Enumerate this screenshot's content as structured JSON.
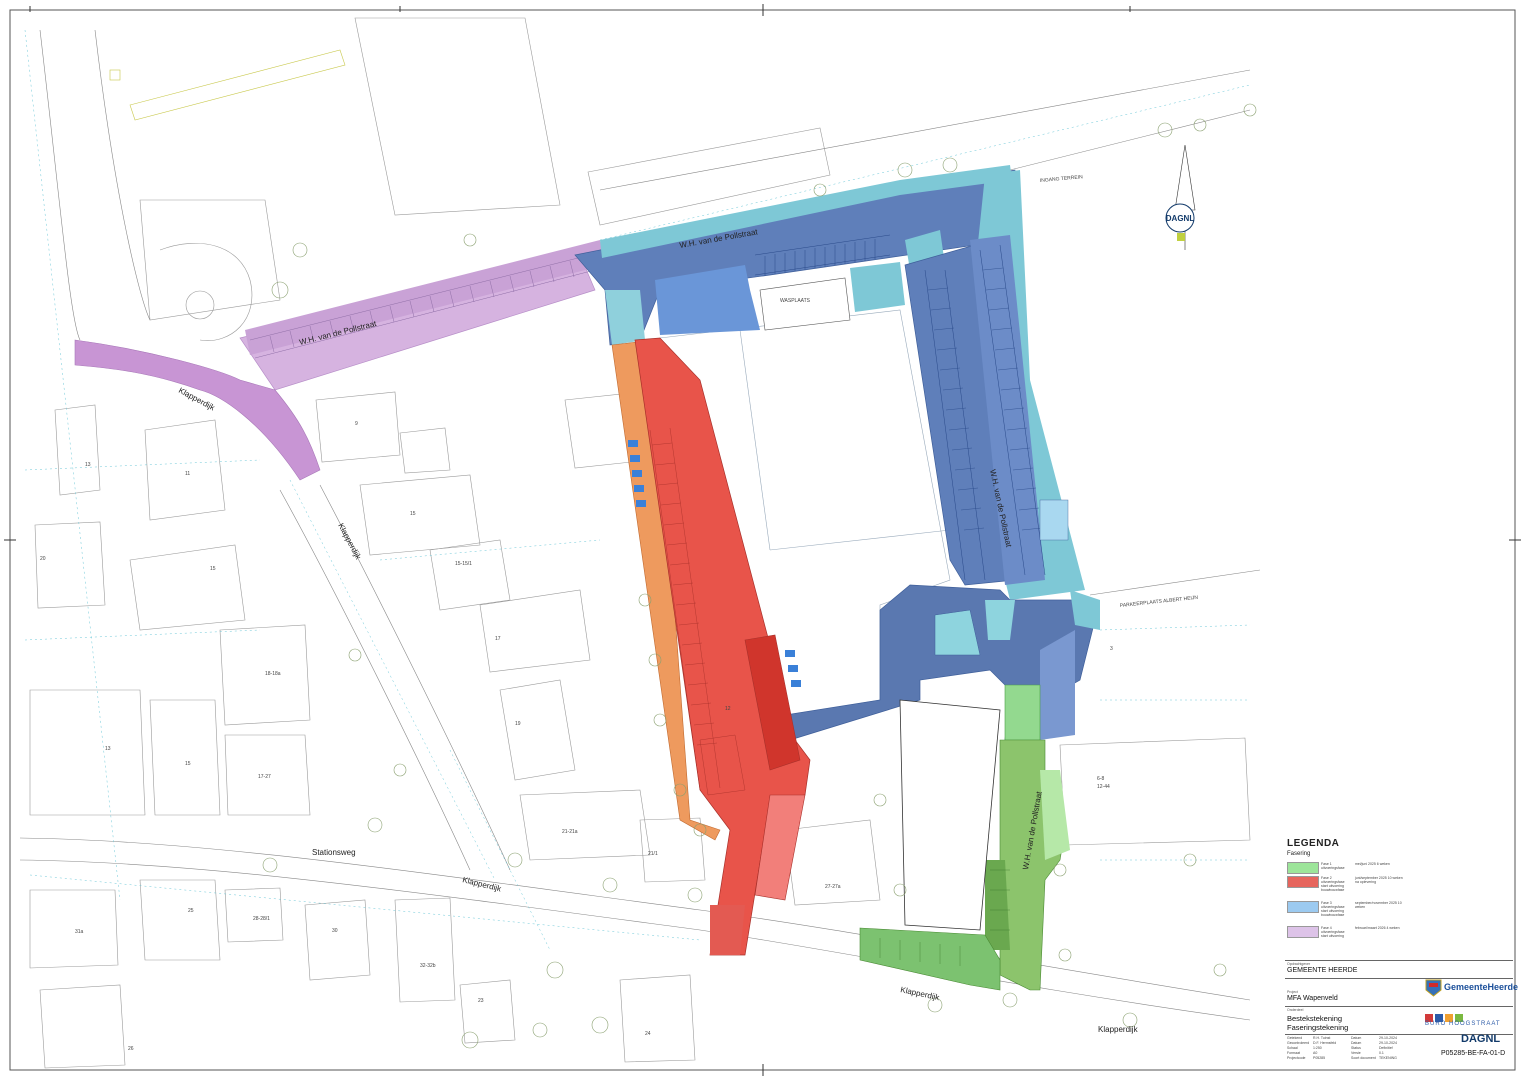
{
  "map": {
    "labels": {
      "street_pollstraat_north": "W.H. van de Pollstraat",
      "street_pollstraat_nw": "W.H. van de Pollstraat",
      "street_pollstraat_east": "W.H. van de Pollstraat",
      "street_pollstraat_south": "W.H. van de Pollstraat",
      "street_klapperdijk_nw": "Klapperdijk",
      "street_klapperdijk_mid": "Klapperdijk",
      "street_klapperdijk_south": "Klapperdijk",
      "street_klapperdijk_se": "Klapperdijk",
      "street_klapperdijk_far": "Klapperdijk",
      "street_stationsweg": "Stationsweg",
      "waspaats": "WASPLAATS",
      "inrit_terrein": "INGANG TERREIN",
      "parkeerplaats": "PARKEERPLAATS ALBERT HEIJN"
    },
    "house_numbers": [
      "13",
      "9",
      "11",
      "15",
      "15-15/1",
      "15",
      "17",
      "19",
      "13",
      "15",
      "17-27",
      "18-18a",
      "21-21a",
      "21/1",
      "27-27a",
      "25",
      "28-28/1",
      "30",
      "32-32b",
      "23",
      "24",
      "26",
      "3",
      "6-8",
      "12-44",
      "31a",
      "20",
      "12"
    ],
    "north_logo": "DAGNL",
    "colors": {
      "phase1": "#93d98f",
      "phase2": "#e8544a",
      "phase3": "#7ab8e8",
      "phase4": "#d6b3e0",
      "blue_dark": "#5b79b3",
      "cyan": "#7ec8d6",
      "orange": "#ee9a5e"
    }
  },
  "legend": {
    "title": "LEGENDA",
    "subtitle": "Fasering",
    "rows": [
      {
        "color": "#9de59a",
        "label": "Fase 1 uitvoeringsfase",
        "desc": "mei/juni 2025 6 weken"
      },
      {
        "color": "#e6655d",
        "label": "Fase 2 uitvoeringsfase start uitvoering bouwbouwfase",
        "desc": "juni/september 2025 10 weken na oplevering"
      },
      {
        "color": "#9ccaf0",
        "label": "Fase 3 uitvoeringsfase start uitvoering bouwbouwfase",
        "desc": "september/november 2025 10 weken"
      },
      {
        "color": "#ddc3e8",
        "label": "Fase 4 uitvoeringsfase start uitvoering",
        "desc": "februari/maart 2026 4 weken"
      }
    ]
  },
  "titleblock": {
    "opdrachtgever_label": "Opdrachtgever",
    "opdrachtgever": "GEMEENTE HEERDE",
    "project_label": "Project",
    "project": "MFA Wapenveld",
    "onderdeel_label": "Onderdeel",
    "onderdeel_1": "Bestekstekening",
    "onderdeel_2": "Faseringstekening",
    "meta": [
      [
        "Getekend",
        "R.H. Tuinst",
        "Datum",
        "29-10-2024"
      ],
      [
        "Gecontroleerd",
        "D.F. Hermsfeld",
        "Datum",
        "29-10-2024"
      ],
      [
        "Schaal",
        "1:250",
        "Status",
        "Definitief"
      ],
      [
        "Formaat",
        "A0",
        "Versie",
        "0.1"
      ],
      [
        "Projectcode",
        "P05285",
        "Soort document",
        "TEKENING"
      ]
    ],
    "heerde_logo": "GemeenteHeerde",
    "buro_logo": "BURO HOOGSTRAAT",
    "dagnl_logo": "DAGNL",
    "drawing_code": "P05285-BE-FA-01-D"
  }
}
